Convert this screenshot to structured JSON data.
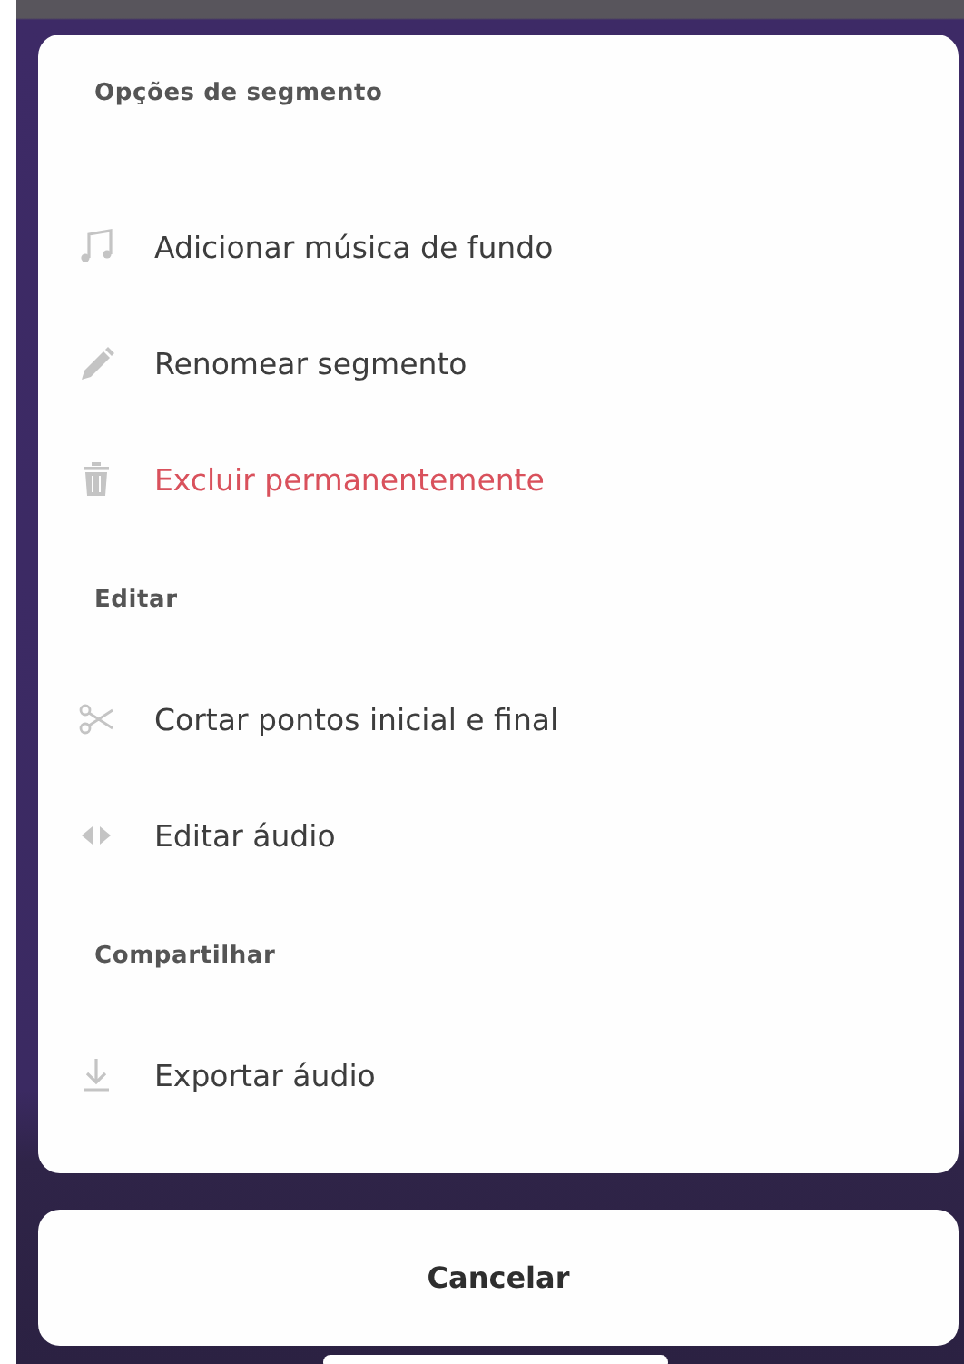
{
  "sections": [
    {
      "title": "Opções de segmento",
      "items": [
        {
          "label": "Adicionar música de fundo",
          "danger": false
        },
        {
          "label": "Renomear segmento",
          "danger": false
        },
        {
          "label": "Excluir permanentemente",
          "danger": true
        }
      ]
    },
    {
      "title": "Editar",
      "items": [
        {
          "label": "Cortar pontos inicial e final",
          "danger": false
        },
        {
          "label": "Editar áudio",
          "danger": false
        }
      ]
    },
    {
      "title": "Compartilhar",
      "items": [
        {
          "label": "Exportar áudio",
          "danger": false
        }
      ]
    }
  ],
  "cancel_button": "Cancelar"
}
